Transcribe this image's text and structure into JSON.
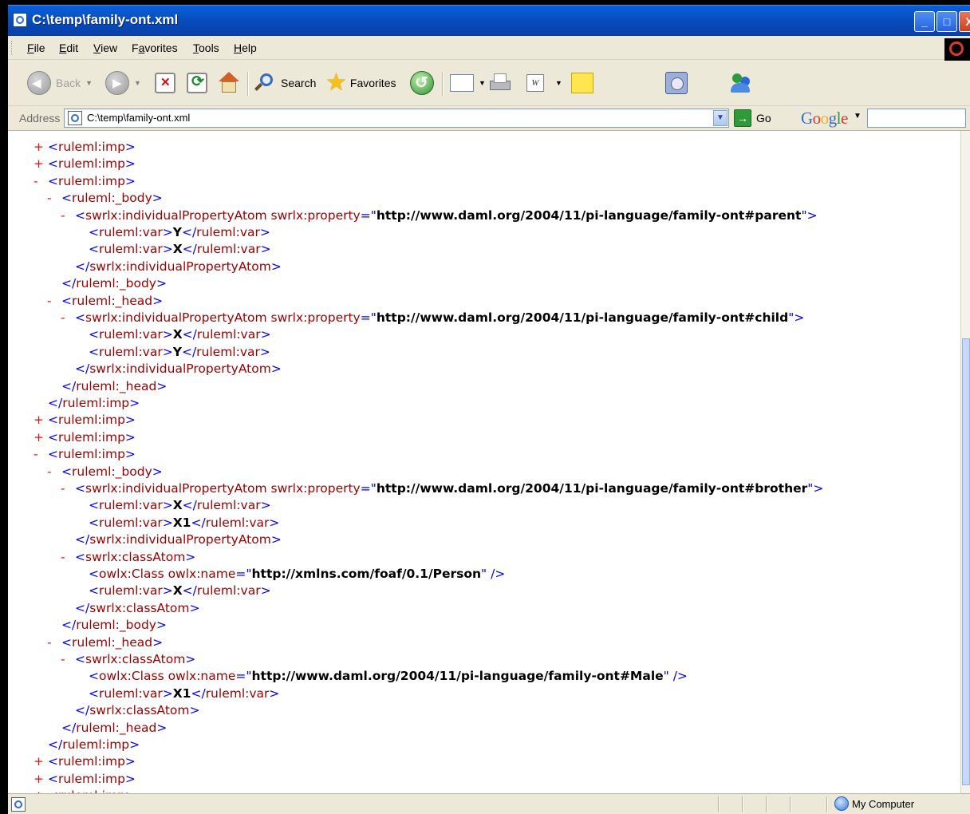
{
  "window": {
    "title": "C:\\temp\\family-ont.xml",
    "min_label": "_",
    "max_label": "□",
    "close_label": "X"
  },
  "menu": {
    "items": [
      {
        "underline": "F",
        "rest": "ile"
      },
      {
        "underline": "E",
        "rest": "dit"
      },
      {
        "underline": "V",
        "rest": "iew"
      },
      {
        "pre": "F",
        "underline": "a",
        "rest": "vorites"
      },
      {
        "underline": "T",
        "rest": "ools"
      },
      {
        "underline": "H",
        "rest": "elp"
      }
    ]
  },
  "toolbar": {
    "back_label": "Back",
    "search_label": "Search",
    "favorites_label": "Favorites",
    "word_icon_label": "W"
  },
  "address": {
    "label": "Address",
    "value": "C:\\temp\\family-ont.xml",
    "go_label": "Go"
  },
  "google": {
    "letters": [
      {
        "char": "G",
        "color": "#3a6ad8"
      },
      {
        "char": "o",
        "color": "#d83a2a"
      },
      {
        "char": "o",
        "color": "#e8b820"
      },
      {
        "char": "g",
        "color": "#3a6ad8"
      },
      {
        "char": "l",
        "color": "#2f9a3a"
      },
      {
        "char": "e",
        "color": "#d83a2a"
      }
    ]
  },
  "xml_lines": [
    {
      "indent": 0,
      "toggle": "+",
      "parts": [
        {
          "c": "br",
          "t": "<"
        },
        {
          "c": "tag",
          "t": "ruleml:imp"
        },
        {
          "c": "br",
          "t": ">"
        }
      ]
    },
    {
      "indent": 0,
      "toggle": "+",
      "parts": [
        {
          "c": "br",
          "t": "<"
        },
        {
          "c": "tag",
          "t": "ruleml:imp"
        },
        {
          "c": "br",
          "t": ">"
        }
      ]
    },
    {
      "indent": 0,
      "toggle": "-",
      "parts": [
        {
          "c": "br",
          "t": "<"
        },
        {
          "c": "tag",
          "t": "ruleml:imp"
        },
        {
          "c": "br",
          "t": ">"
        }
      ]
    },
    {
      "indent": 1,
      "toggle": "-",
      "parts": [
        {
          "c": "br",
          "t": "<"
        },
        {
          "c": "tag",
          "t": "ruleml:_body"
        },
        {
          "c": "br",
          "t": ">"
        }
      ]
    },
    {
      "indent": 2,
      "toggle": "-",
      "parts": [
        {
          "c": "br",
          "t": "<"
        },
        {
          "c": "tag",
          "t": "swrlx:individualPropertyAtom swrlx:property"
        },
        {
          "c": "br",
          "t": "=\""
        },
        {
          "c": "val",
          "t": "http://www.daml.org/2004/11/pi-language/family-ont#parent"
        },
        {
          "c": "br",
          "t": "\">"
        }
      ]
    },
    {
      "indent": 3,
      "toggle": "",
      "parts": [
        {
          "c": "br",
          "t": "<"
        },
        {
          "c": "tag",
          "t": "ruleml:var"
        },
        {
          "c": "br",
          "t": ">"
        },
        {
          "c": "val",
          "t": "Y"
        },
        {
          "c": "br",
          "t": "</"
        },
        {
          "c": "tag",
          "t": "ruleml:var"
        },
        {
          "c": "br",
          "t": ">"
        }
      ]
    },
    {
      "indent": 3,
      "toggle": "",
      "parts": [
        {
          "c": "br",
          "t": "<"
        },
        {
          "c": "tag",
          "t": "ruleml:var"
        },
        {
          "c": "br",
          "t": ">"
        },
        {
          "c": "val",
          "t": "X"
        },
        {
          "c": "br",
          "t": "</"
        },
        {
          "c": "tag",
          "t": "ruleml:var"
        },
        {
          "c": "br",
          "t": ">"
        }
      ]
    },
    {
      "indent": 2,
      "toggle": "",
      "parts": [
        {
          "c": "br",
          "t": "</"
        },
        {
          "c": "tag",
          "t": "swrlx:individualPropertyAtom"
        },
        {
          "c": "br",
          "t": ">"
        }
      ]
    },
    {
      "indent": 1,
      "toggle": "",
      "parts": [
        {
          "c": "br",
          "t": "</"
        },
        {
          "c": "tag",
          "t": "ruleml:_body"
        },
        {
          "c": "br",
          "t": ">"
        }
      ]
    },
    {
      "indent": 1,
      "toggle": "-",
      "parts": [
        {
          "c": "br",
          "t": "<"
        },
        {
          "c": "tag",
          "t": "ruleml:_head"
        },
        {
          "c": "br",
          "t": ">"
        }
      ]
    },
    {
      "indent": 2,
      "toggle": "-",
      "parts": [
        {
          "c": "br",
          "t": "<"
        },
        {
          "c": "tag",
          "t": "swrlx:individualPropertyAtom swrlx:property"
        },
        {
          "c": "br",
          "t": "=\""
        },
        {
          "c": "val",
          "t": "http://www.daml.org/2004/11/pi-language/family-ont#child"
        },
        {
          "c": "br",
          "t": "\">"
        }
      ]
    },
    {
      "indent": 3,
      "toggle": "",
      "parts": [
        {
          "c": "br",
          "t": "<"
        },
        {
          "c": "tag",
          "t": "ruleml:var"
        },
        {
          "c": "br",
          "t": ">"
        },
        {
          "c": "val",
          "t": "X"
        },
        {
          "c": "br",
          "t": "</"
        },
        {
          "c": "tag",
          "t": "ruleml:var"
        },
        {
          "c": "br",
          "t": ">"
        }
      ]
    },
    {
      "indent": 3,
      "toggle": "",
      "parts": [
        {
          "c": "br",
          "t": "<"
        },
        {
          "c": "tag",
          "t": "ruleml:var"
        },
        {
          "c": "br",
          "t": ">"
        },
        {
          "c": "val",
          "t": "Y"
        },
        {
          "c": "br",
          "t": "</"
        },
        {
          "c": "tag",
          "t": "ruleml:var"
        },
        {
          "c": "br",
          "t": ">"
        }
      ]
    },
    {
      "indent": 2,
      "toggle": "",
      "parts": [
        {
          "c": "br",
          "t": "</"
        },
        {
          "c": "tag",
          "t": "swrlx:individualPropertyAtom"
        },
        {
          "c": "br",
          "t": ">"
        }
      ]
    },
    {
      "indent": 1,
      "toggle": "",
      "parts": [
        {
          "c": "br",
          "t": "</"
        },
        {
          "c": "tag",
          "t": "ruleml:_head"
        },
        {
          "c": "br",
          "t": ">"
        }
      ]
    },
    {
      "indent": 0,
      "toggle": "",
      "parts": [
        {
          "c": "br",
          "t": "</"
        },
        {
          "c": "tag",
          "t": "ruleml:imp"
        },
        {
          "c": "br",
          "t": ">"
        }
      ]
    },
    {
      "indent": 0,
      "toggle": "+",
      "parts": [
        {
          "c": "br",
          "t": "<"
        },
        {
          "c": "tag",
          "t": "ruleml:imp"
        },
        {
          "c": "br",
          "t": ">"
        }
      ]
    },
    {
      "indent": 0,
      "toggle": "+",
      "parts": [
        {
          "c": "br",
          "t": "<"
        },
        {
          "c": "tag",
          "t": "ruleml:imp"
        },
        {
          "c": "br",
          "t": ">"
        }
      ]
    },
    {
      "indent": 0,
      "toggle": "-",
      "parts": [
        {
          "c": "br",
          "t": "<"
        },
        {
          "c": "tag",
          "t": "ruleml:imp"
        },
        {
          "c": "br",
          "t": ">"
        }
      ]
    },
    {
      "indent": 1,
      "toggle": "-",
      "parts": [
        {
          "c": "br",
          "t": "<"
        },
        {
          "c": "tag",
          "t": "ruleml:_body"
        },
        {
          "c": "br",
          "t": ">"
        }
      ]
    },
    {
      "indent": 2,
      "toggle": "-",
      "parts": [
        {
          "c": "br",
          "t": "<"
        },
        {
          "c": "tag",
          "t": "swrlx:individualPropertyAtom swrlx:property"
        },
        {
          "c": "br",
          "t": "=\""
        },
        {
          "c": "val",
          "t": "http://www.daml.org/2004/11/pi-language/family-ont#brother"
        },
        {
          "c": "br",
          "t": "\">"
        }
      ]
    },
    {
      "indent": 3,
      "toggle": "",
      "parts": [
        {
          "c": "br",
          "t": "<"
        },
        {
          "c": "tag",
          "t": "ruleml:var"
        },
        {
          "c": "br",
          "t": ">"
        },
        {
          "c": "val",
          "t": "X"
        },
        {
          "c": "br",
          "t": "</"
        },
        {
          "c": "tag",
          "t": "ruleml:var"
        },
        {
          "c": "br",
          "t": ">"
        }
      ]
    },
    {
      "indent": 3,
      "toggle": "",
      "parts": [
        {
          "c": "br",
          "t": "<"
        },
        {
          "c": "tag",
          "t": "ruleml:var"
        },
        {
          "c": "br",
          "t": ">"
        },
        {
          "c": "val",
          "t": "X1"
        },
        {
          "c": "br",
          "t": "</"
        },
        {
          "c": "tag",
          "t": "ruleml:var"
        },
        {
          "c": "br",
          "t": ">"
        }
      ]
    },
    {
      "indent": 2,
      "toggle": "",
      "parts": [
        {
          "c": "br",
          "t": "</"
        },
        {
          "c": "tag",
          "t": "swrlx:individualPropertyAtom"
        },
        {
          "c": "br",
          "t": ">"
        }
      ]
    },
    {
      "indent": 2,
      "toggle": "-",
      "parts": [
        {
          "c": "br",
          "t": "<"
        },
        {
          "c": "tag",
          "t": "swrlx:classAtom"
        },
        {
          "c": "br",
          "t": ">"
        }
      ]
    },
    {
      "indent": 3,
      "toggle": "",
      "parts": [
        {
          "c": "br",
          "t": "<"
        },
        {
          "c": "tag",
          "t": "owlx:Class owlx:name"
        },
        {
          "c": "br",
          "t": "=\""
        },
        {
          "c": "val",
          "t": "http://xmlns.com/foaf/0.1/Person"
        },
        {
          "c": "br",
          "t": "\" />"
        }
      ]
    },
    {
      "indent": 3,
      "toggle": "",
      "parts": [
        {
          "c": "br",
          "t": "<"
        },
        {
          "c": "tag",
          "t": "ruleml:var"
        },
        {
          "c": "br",
          "t": ">"
        },
        {
          "c": "val",
          "t": "X"
        },
        {
          "c": "br",
          "t": "</"
        },
        {
          "c": "tag",
          "t": "ruleml:var"
        },
        {
          "c": "br",
          "t": ">"
        }
      ]
    },
    {
      "indent": 2,
      "toggle": "",
      "parts": [
        {
          "c": "br",
          "t": "</"
        },
        {
          "c": "tag",
          "t": "swrlx:classAtom"
        },
        {
          "c": "br",
          "t": ">"
        }
      ]
    },
    {
      "indent": 1,
      "toggle": "",
      "parts": [
        {
          "c": "br",
          "t": "</"
        },
        {
          "c": "tag",
          "t": "ruleml:_body"
        },
        {
          "c": "br",
          "t": ">"
        }
      ]
    },
    {
      "indent": 1,
      "toggle": "-",
      "parts": [
        {
          "c": "br",
          "t": "<"
        },
        {
          "c": "tag",
          "t": "ruleml:_head"
        },
        {
          "c": "br",
          "t": ">"
        }
      ]
    },
    {
      "indent": 2,
      "toggle": "-",
      "parts": [
        {
          "c": "br",
          "t": "<"
        },
        {
          "c": "tag",
          "t": "swrlx:classAtom"
        },
        {
          "c": "br",
          "t": ">"
        }
      ]
    },
    {
      "indent": 3,
      "toggle": "",
      "parts": [
        {
          "c": "br",
          "t": "<"
        },
        {
          "c": "tag",
          "t": "owlx:Class owlx:name"
        },
        {
          "c": "br",
          "t": "=\""
        },
        {
          "c": "val",
          "t": "http://www.daml.org/2004/11/pi-language/family-ont#Male"
        },
        {
          "c": "br",
          "t": "\" />"
        }
      ]
    },
    {
      "indent": 3,
      "toggle": "",
      "parts": [
        {
          "c": "br",
          "t": "<"
        },
        {
          "c": "tag",
          "t": "ruleml:var"
        },
        {
          "c": "br",
          "t": ">"
        },
        {
          "c": "val",
          "t": "X1"
        },
        {
          "c": "br",
          "t": "</"
        },
        {
          "c": "tag",
          "t": "ruleml:var"
        },
        {
          "c": "br",
          "t": ">"
        }
      ]
    },
    {
      "indent": 2,
      "toggle": "",
      "parts": [
        {
          "c": "br",
          "t": "</"
        },
        {
          "c": "tag",
          "t": "swrlx:classAtom"
        },
        {
          "c": "br",
          "t": ">"
        }
      ]
    },
    {
      "indent": 1,
      "toggle": "",
      "parts": [
        {
          "c": "br",
          "t": "</"
        },
        {
          "c": "tag",
          "t": "ruleml:_head"
        },
        {
          "c": "br",
          "t": ">"
        }
      ]
    },
    {
      "indent": 0,
      "toggle": "",
      "parts": [
        {
          "c": "br",
          "t": "</"
        },
        {
          "c": "tag",
          "t": "ruleml:imp"
        },
        {
          "c": "br",
          "t": ">"
        }
      ]
    },
    {
      "indent": 0,
      "toggle": "+",
      "parts": [
        {
          "c": "br",
          "t": "<"
        },
        {
          "c": "tag",
          "t": "ruleml:imp"
        },
        {
          "c": "br",
          "t": ">"
        }
      ]
    },
    {
      "indent": 0,
      "toggle": "+",
      "parts": [
        {
          "c": "br",
          "t": "<"
        },
        {
          "c": "tag",
          "t": "ruleml:imp"
        },
        {
          "c": "br",
          "t": ">"
        }
      ]
    },
    {
      "indent": 0,
      "toggle": "+",
      "parts": [
        {
          "c": "br",
          "t": "<"
        },
        {
          "c": "tag",
          "t": "ruleml:imp"
        },
        {
          "c": "br",
          "t": ">"
        }
      ]
    }
  ],
  "status": {
    "zone": "My Computer"
  }
}
